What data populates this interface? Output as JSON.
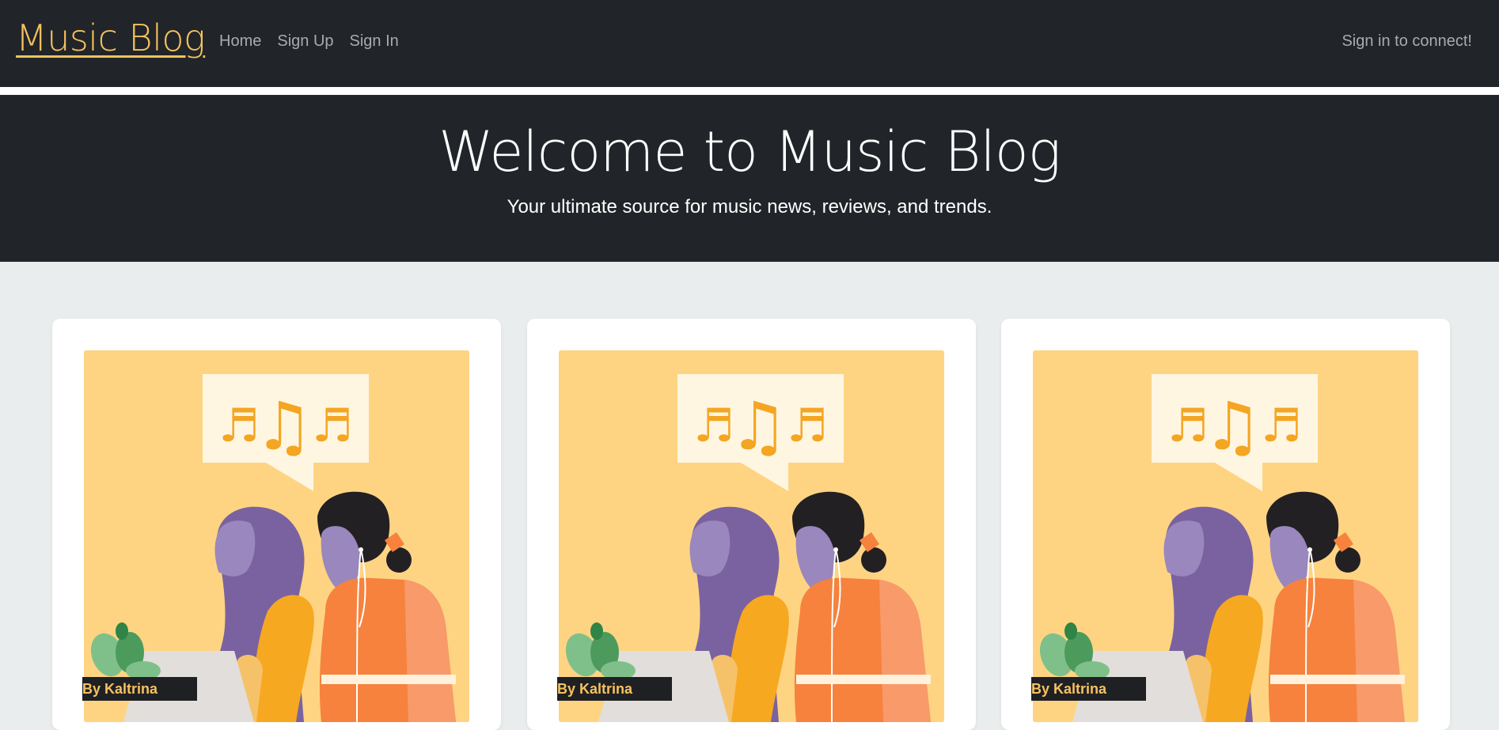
{
  "navbar": {
    "brand": "Music Blog",
    "links": [
      "Home",
      "Sign Up",
      "Sign In"
    ],
    "right_text": "Sign in to connect!"
  },
  "hero": {
    "title": "Welcome to Music Blog",
    "subtitle": "Your ultimate source for music news, reviews, and trends."
  },
  "cards": [
    {
      "author": "By Kaltrina",
      "image_icon": "music-illustration"
    },
    {
      "author": "By Kaltrina",
      "image_icon": "music-illustration"
    },
    {
      "author": "By Kaltrina",
      "image_icon": "music-illustration"
    }
  ],
  "colors": {
    "navbar_bg": "#212529",
    "brand": "#f6c25e",
    "page_bg": "#eaeded",
    "illustration_bg": "#fed482"
  }
}
